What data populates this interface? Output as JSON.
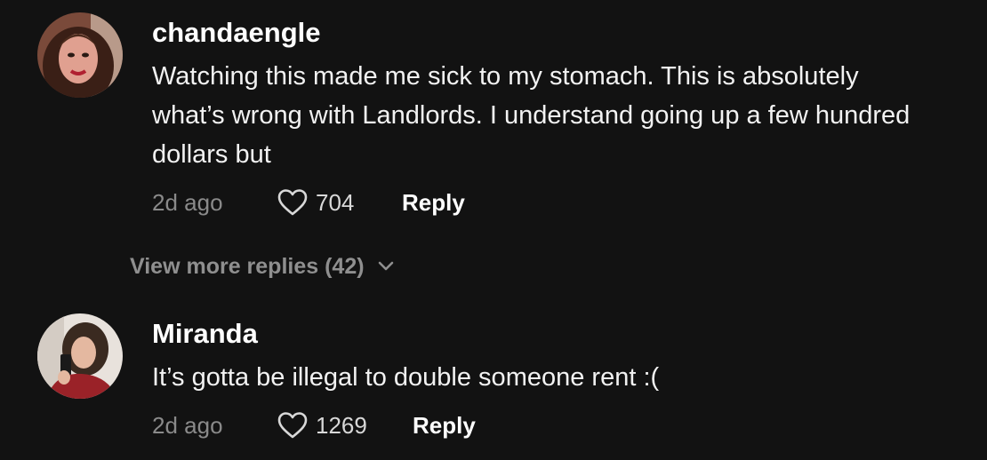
{
  "comments": [
    {
      "username": "chandaengle",
      "text": "Watching this made me sick to my stomach. This is absolutely what’s wrong with Landlords. I understand going up a few hundred dollars but",
      "timestamp": "2d ago",
      "likes": "704",
      "reply_label": "Reply",
      "avatar_icon": "avatar-photo-icon"
    },
    {
      "username": "Miranda",
      "text": "It’s gotta be illegal to double someone rent :(",
      "timestamp": "2d ago",
      "likes": "1269",
      "reply_label": "Reply",
      "avatar_icon": "avatar-photo-icon"
    }
  ],
  "view_more_replies": "View more replies (42)",
  "colors": {
    "background": "#121212",
    "muted_text": "#8a8a8a",
    "primary_text": "#ffffff"
  }
}
